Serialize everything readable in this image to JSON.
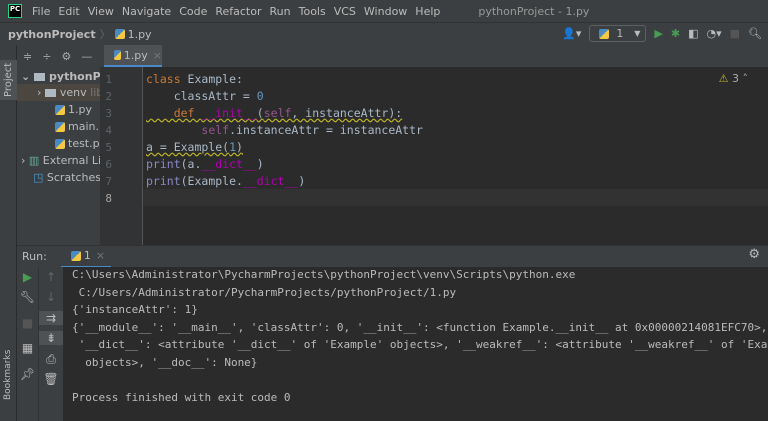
{
  "menubar": {
    "items": [
      "File",
      "Edit",
      "View",
      "Navigate",
      "Code",
      "Refactor",
      "Run",
      "Tools",
      "VCS",
      "Window",
      "Help"
    ],
    "window_title": "pythonProject - 1.py",
    "logo": "PC"
  },
  "navbar": {
    "project": "pythonProject",
    "file": "1.py"
  },
  "run_config": {
    "name": "1"
  },
  "side": {
    "project_tab": "Project",
    "bookmarks_tab": "Bookmarks"
  },
  "editor_tab": {
    "label": "1.py"
  },
  "project_tree": [
    {
      "label": "pythonProject",
      "icon": "folder-icon"
    },
    {
      "label": "venv",
      "suffix": "libr",
      "icon": "folder-icon"
    },
    {
      "label": "1.py",
      "icon": "python-file-icon"
    },
    {
      "label": "main.py",
      "icon": "python-file-icon"
    },
    {
      "label": "test.py",
      "icon": "python-file-icon"
    },
    {
      "label": "External Libraries",
      "icon": "library-icon"
    },
    {
      "label": "Scratches and Consoles",
      "icon": "scratches-icon"
    }
  ],
  "editor": {
    "line_numbers": [
      "1",
      "2",
      "3",
      "4",
      "5",
      "6",
      "7",
      "8"
    ],
    "warnings": "3",
    "lines": [
      [
        [
          "kw",
          "class "
        ],
        [
          "",
          "Example:"
        ]
      ],
      [
        [
          "",
          "    classAttr = "
        ],
        [
          "nu",
          "0"
        ]
      ],
      [
        [
          "kw",
          "    def "
        ],
        [
          "fn",
          "__init__"
        ],
        [
          "",
          "("
        ],
        [
          "sf",
          "self"
        ],
        [
          "",
          ", instanceAttr):"
        ]
      ],
      [
        [
          "",
          "        "
        ],
        [
          "sf",
          "self"
        ],
        [
          "",
          ".instanceAttr = instanceAttr"
        ]
      ],
      [
        [
          "",
          "a = Example("
        ],
        [
          "nu",
          "1"
        ],
        [
          "",
          ")"
        ]
      ],
      [
        [
          "bi",
          "print"
        ],
        [
          "",
          "(a."
        ],
        [
          "du",
          "__dict__"
        ],
        [
          "",
          ")"
        ]
      ],
      [
        [
          "bi",
          "print"
        ],
        [
          "",
          "(Example."
        ],
        [
          "du",
          "__dict__"
        ],
        [
          "",
          ")"
        ]
      ],
      [
        [
          "",
          ""
        ]
      ]
    ]
  },
  "run": {
    "label": "Run:",
    "tab": "1",
    "output": [
      "C:\\Users\\Administrator\\PycharmProjects\\pythonProject\\venv\\Scripts\\python.exe",
      " C:/Users/Administrator/PycharmProjects/pythonProject/1.py",
      "{'instanceAttr': 1}",
      "{'__module__': '__main__', 'classAttr': 0, '__init__': <function Example.__init__ at 0x00000214081EFC70>,",
      " '__dict__': <attribute '__dict__' of 'Example' objects>, '__weakref__': <attribute '__weakref__' of 'Example'",
      "  objects>, '__doc__': None}",
      "",
      "Process finished with exit code 0"
    ]
  }
}
